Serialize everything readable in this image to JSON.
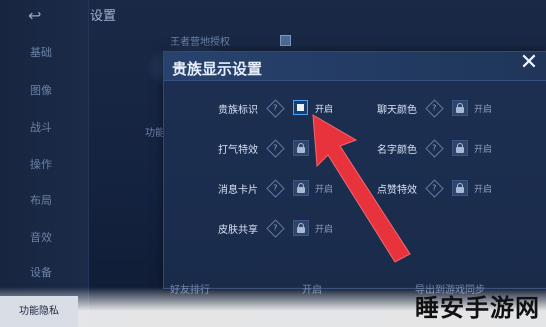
{
  "page": {
    "title": "设置"
  },
  "sidebar": {
    "back_glyph": "↩",
    "items": [
      "基础",
      "图像",
      "战斗",
      "操作",
      "布局",
      "音效",
      "设备",
      "功能隐私"
    ]
  },
  "background": {
    "top_item": "王者营地授权",
    "mid_item": "功能",
    "bottom_item_left": "好友排行",
    "bottom_item_on": "开启",
    "bottom_item_right": "导出到游戏同步"
  },
  "dialog": {
    "title": "贵族显示设置",
    "close_glyph": "✕",
    "rows": [
      {
        "label": "贵族标识",
        "control": "checkbox",
        "state": "开启"
      },
      {
        "label": "聊天颜色",
        "control": "lock",
        "state": "开启"
      },
      {
        "label": "打气特效",
        "control": "lock",
        "state": "开启"
      },
      {
        "label": "名字颜色",
        "control": "lock",
        "state": "开启"
      },
      {
        "label": "消息卡片",
        "control": "lock",
        "state": "开启"
      },
      {
        "label": "点赞特效",
        "control": "lock",
        "state": "开启"
      },
      {
        "label": "皮肤共享",
        "control": "lock",
        "state": "开启"
      }
    ],
    "help_glyph": "?"
  },
  "watermark": "睡安手游网",
  "colors": {
    "accent": "#4aa3ff",
    "arrow": "#e8323c",
    "dialog_bg": "#1d3053"
  }
}
